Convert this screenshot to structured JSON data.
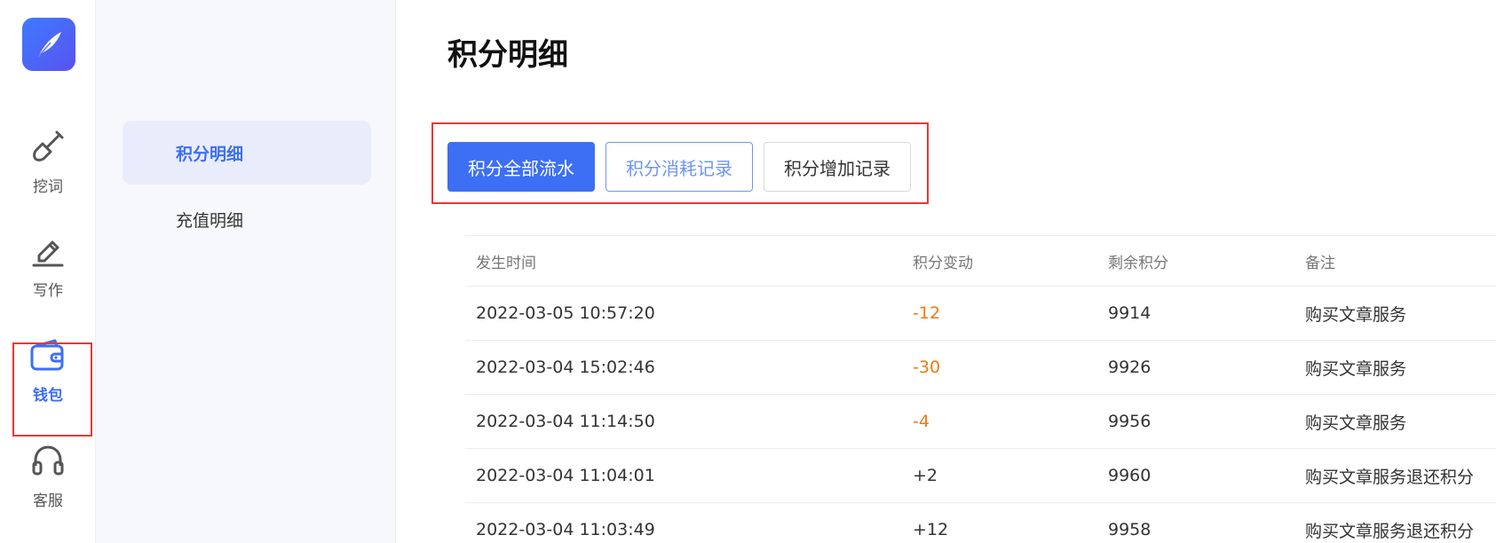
{
  "rail": {
    "items": [
      {
        "label": "挖词",
        "icon": "shovel-icon"
      },
      {
        "label": "写作",
        "icon": "pen-icon"
      },
      {
        "label": "钱包",
        "icon": "wallet-icon"
      },
      {
        "label": "客服",
        "icon": "headset-icon"
      }
    ],
    "active_index": 2
  },
  "subnav": {
    "items": [
      {
        "label": "积分明细"
      },
      {
        "label": "充值明细"
      }
    ],
    "active_index": 0
  },
  "main": {
    "title": "积分明细",
    "tabs": [
      {
        "label": "积分全部流水"
      },
      {
        "label": "积分消耗记录"
      },
      {
        "label": "积分增加记录"
      }
    ],
    "table": {
      "headers": [
        "发生时间",
        "积分变动",
        "剩余积分",
        "备注"
      ],
      "rows": [
        {
          "time": "2022-03-05 10:57:20",
          "change": "-12",
          "remain": "9914",
          "note": "购买文章服务"
        },
        {
          "time": "2022-03-04 15:02:46",
          "change": "-30",
          "remain": "9926",
          "note": "购买文章服务"
        },
        {
          "time": "2022-03-04 11:14:50",
          "change": "-4",
          "remain": "9956",
          "note": "购买文章服务"
        },
        {
          "time": "2022-03-04 11:04:01",
          "change": "+2",
          "remain": "9960",
          "note": "购买文章服务退还积分"
        },
        {
          "time": "2022-03-04 11:03:49",
          "change": "+12",
          "remain": "9958",
          "note": "购买文章服务退还积分"
        }
      ]
    }
  },
  "colors": {
    "accent": "#3d6ff5",
    "negative": "#f07a11",
    "highlight_box": "#e53935"
  }
}
